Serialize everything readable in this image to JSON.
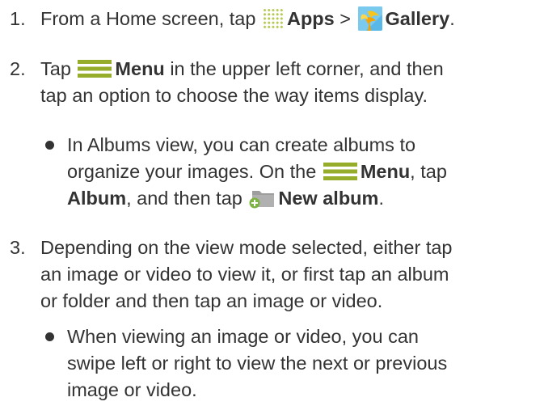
{
  "colors": {
    "text": "#333333",
    "accent": "#96ad2c"
  },
  "icons": [
    "apps-grid-icon",
    "gallery-icon",
    "menu-icon",
    "new-album-icon"
  ],
  "step1": {
    "num": "1.",
    "pre": "From a Home screen, tap",
    "apps": "Apps",
    "sep": ">",
    "gallery": "Gallery",
    "end": "."
  },
  "step2": {
    "num": "2.",
    "pre": "Tap",
    "menu": "Menu",
    "line1_post": "in the upper left corner, and then",
    "line2": "tap an option to choose the way items display."
  },
  "bullet1": {
    "line1": "In Albums view, you can create albums to",
    "line2_pre": "organize your images. On the",
    "menu": "Menu",
    "line2_post": ", tap",
    "album": "Album",
    "line3_mid": ", and then tap",
    "new_album": "New album",
    "end": "."
  },
  "step3": {
    "num": "3.",
    "line1": "Depending on the view mode selected, either tap",
    "line2": "an image or video to view it, or first tap an album",
    "line3": "or folder and then tap an image or video."
  },
  "bullet2": {
    "line1": "When viewing an image or video, you can",
    "line2": "swipe left or right to view the next or previous",
    "line3": "image or video."
  }
}
